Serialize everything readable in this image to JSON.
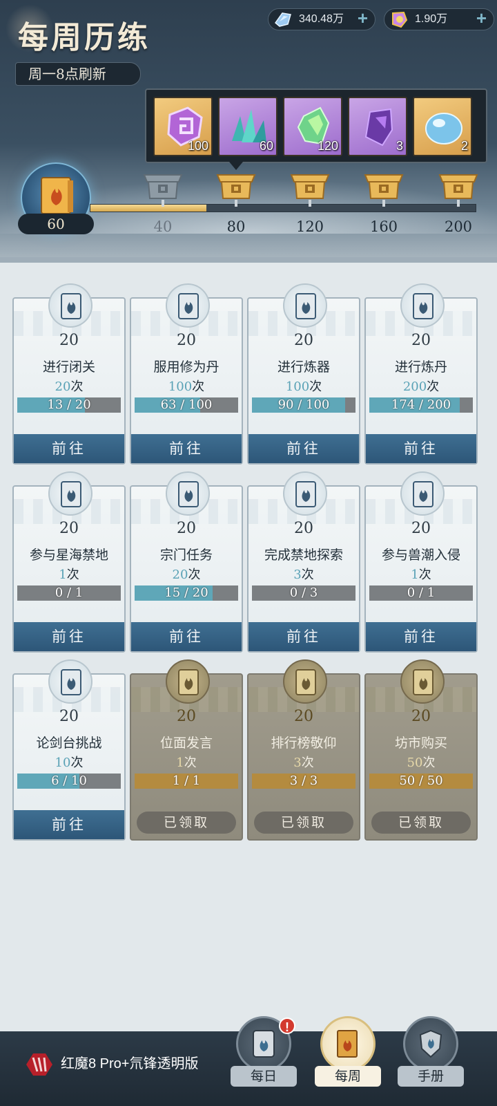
{
  "header": {
    "title": "每周历练",
    "refresh_note": "周一8点刷新"
  },
  "currencies": [
    {
      "icon": "spirit-stone-icon",
      "value": "340.48万"
    },
    {
      "icon": "token-icon",
      "value": "1.90万"
    }
  ],
  "reward_preview": [
    {
      "icon": "purple-talisman-icon",
      "qty": "100",
      "rarity": "gold"
    },
    {
      "icon": "teal-crystal-cluster-icon",
      "qty": "60",
      "rarity": "purple"
    },
    {
      "icon": "green-gem-icon",
      "qty": "120",
      "rarity": "purple"
    },
    {
      "icon": "violet-crystal-icon",
      "qty": "3",
      "rarity": "purple"
    },
    {
      "icon": "blue-spirit-orb-icon",
      "qty": "2",
      "rarity": "gold"
    }
  ],
  "progress": {
    "current_points": "60",
    "max_points": 200,
    "fill_fraction": 0.3,
    "milestones": [
      {
        "label": "40",
        "claimed": true
      },
      {
        "label": "80",
        "claimed": false
      },
      {
        "label": "120",
        "claimed": false
      },
      {
        "label": "160",
        "claimed": false
      },
      {
        "label": "200",
        "claimed": false
      }
    ]
  },
  "tasks": [
    {
      "points": "20",
      "name": "进行闭关",
      "target": "20",
      "unit": "次",
      "progress": "13 / 20",
      "fraction": 0.65,
      "status": "go",
      "button": "前往"
    },
    {
      "points": "20",
      "name": "服用修为丹",
      "target": "100",
      "unit": "次",
      "progress": "63 / 100",
      "fraction": 0.63,
      "status": "go",
      "button": "前往"
    },
    {
      "points": "20",
      "name": "进行炼器",
      "target": "100",
      "unit": "次",
      "progress": "90 / 100",
      "fraction": 0.9,
      "status": "go",
      "button": "前往"
    },
    {
      "points": "20",
      "name": "进行炼丹",
      "target": "200",
      "unit": "次",
      "progress": "174 / 200",
      "fraction": 0.87,
      "status": "go",
      "button": "前往"
    },
    {
      "points": "20",
      "name": "参与星海禁地",
      "target": "1",
      "unit": "次",
      "progress": "0 / 1",
      "fraction": 0,
      "status": "go",
      "button": "前往"
    },
    {
      "points": "20",
      "name": "宗门任务",
      "target": "20",
      "unit": "次",
      "progress": "15 / 20",
      "fraction": 0.75,
      "status": "go",
      "button": "前往"
    },
    {
      "points": "20",
      "name": "完成禁地探索",
      "target": "3",
      "unit": "次",
      "progress": "0 / 3",
      "fraction": 0,
      "status": "go",
      "button": "前往"
    },
    {
      "points": "20",
      "name": "参与兽潮入侵",
      "target": "1",
      "unit": "次",
      "progress": "0 / 1",
      "fraction": 0,
      "status": "go",
      "button": "前往"
    },
    {
      "points": "20",
      "name": "论剑台挑战",
      "target": "10",
      "unit": "次",
      "progress": "6 / 10",
      "fraction": 0.6,
      "status": "go",
      "button": "前往"
    },
    {
      "points": "20",
      "name": "位面发言",
      "target": "1",
      "unit": "次",
      "progress": "1 / 1",
      "fraction": 1,
      "status": "claimed",
      "button": "已领取"
    },
    {
      "points": "20",
      "name": "排行榜敬仰",
      "target": "3",
      "unit": "次",
      "progress": "3 / 3",
      "fraction": 1,
      "status": "claimed",
      "button": "已领取"
    },
    {
      "points": "20",
      "name": "坊市购买",
      "target": "50",
      "unit": "次",
      "progress": "50 / 50",
      "fraction": 1,
      "status": "claimed",
      "button": "已领取"
    }
  ],
  "bottom_nav": {
    "device_label": "红魔8 Pro+氘锋透明版",
    "tabs": [
      {
        "label": "每日",
        "active": false,
        "badge": "!"
      },
      {
        "label": "每周",
        "active": true
      },
      {
        "label": "手册",
        "active": false
      }
    ]
  },
  "colors": {
    "accent_blue": "#5fa7b8",
    "button_blue": "#2d5678",
    "gold": "#d6a94f",
    "claimed_card": "#8f8b7d"
  }
}
